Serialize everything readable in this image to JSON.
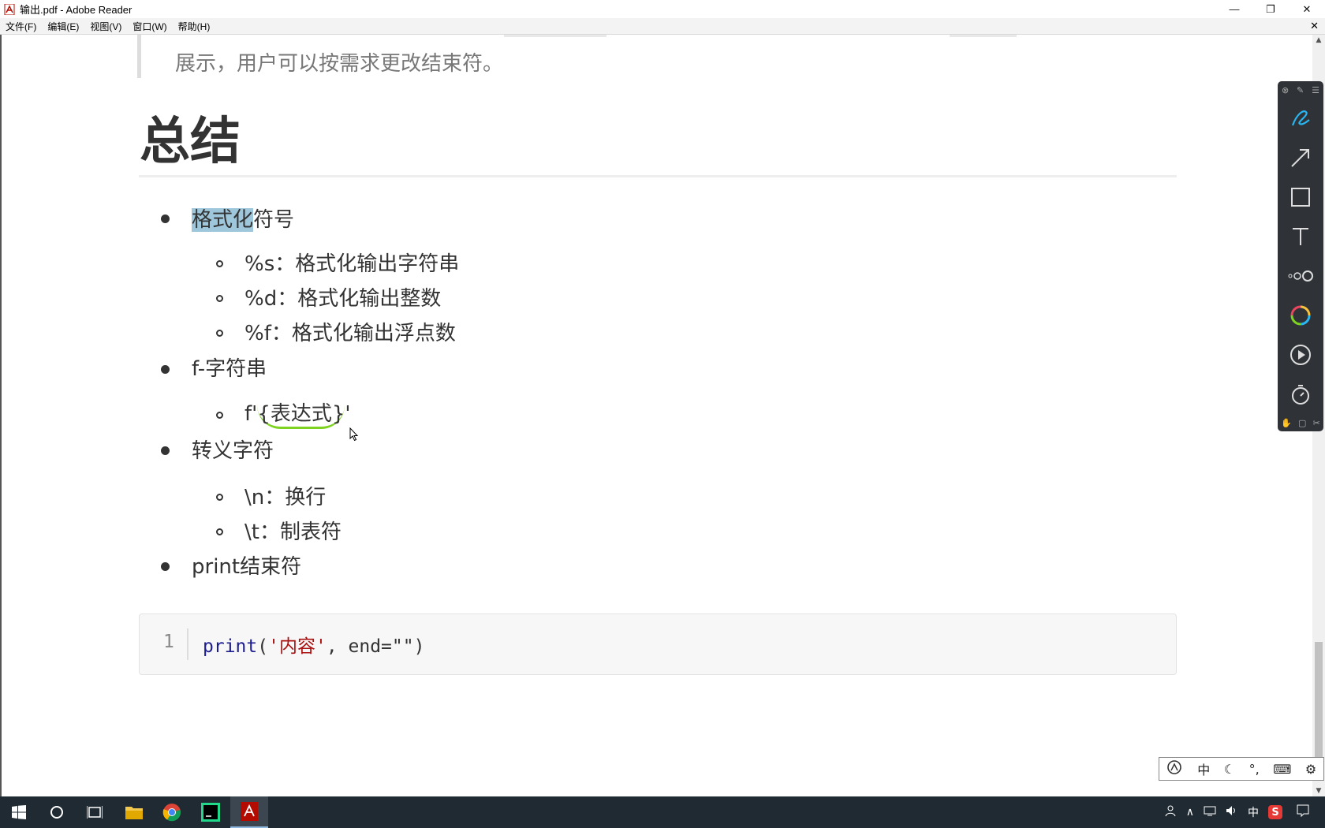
{
  "window": {
    "title": "输出.pdf - Adobe Reader",
    "minimize": "—",
    "restore": "❐",
    "close": "✕"
  },
  "menu": {
    "items": [
      "文件(F)",
      "编辑(E)",
      "视图(V)",
      "窗口(W)",
      "帮助(H)"
    ],
    "close": "✕"
  },
  "document": {
    "quote_text": "展示，用户可以按需求更改结束符。",
    "heading": "总结",
    "bullets": [
      {
        "label_highlighted": "格式化",
        "label_rest": "符号",
        "subitems": [
          "%s：格式化输出字符串",
          "%d：格式化输出整数",
          "%f：格式化输出浮点数"
        ]
      },
      {
        "label": "f-字符串",
        "subitems_prefix": "f'",
        "subitems_underlined": "{表达式}",
        "subitems_suffix": "'"
      },
      {
        "label": "转义字符",
        "subitems": [
          "\\n：换行",
          "\\t：制表符"
        ]
      },
      {
        "label": "print结束符"
      }
    ],
    "code": {
      "line_number": "1",
      "func": "print",
      "open": "(",
      "string": "'内容'",
      "rest": ", end=\"\")"
    }
  },
  "ime": {
    "items": [
      "中",
      "☾",
      "°,",
      "⌨",
      "⚙"
    ]
  },
  "taskbar": {
    "tray": [
      "∧",
      "中",
      "S"
    ]
  },
  "colors": {
    "highlight": "#9fc7dc",
    "underline": "#7ed321",
    "pen_active": "#2ab6f0"
  }
}
